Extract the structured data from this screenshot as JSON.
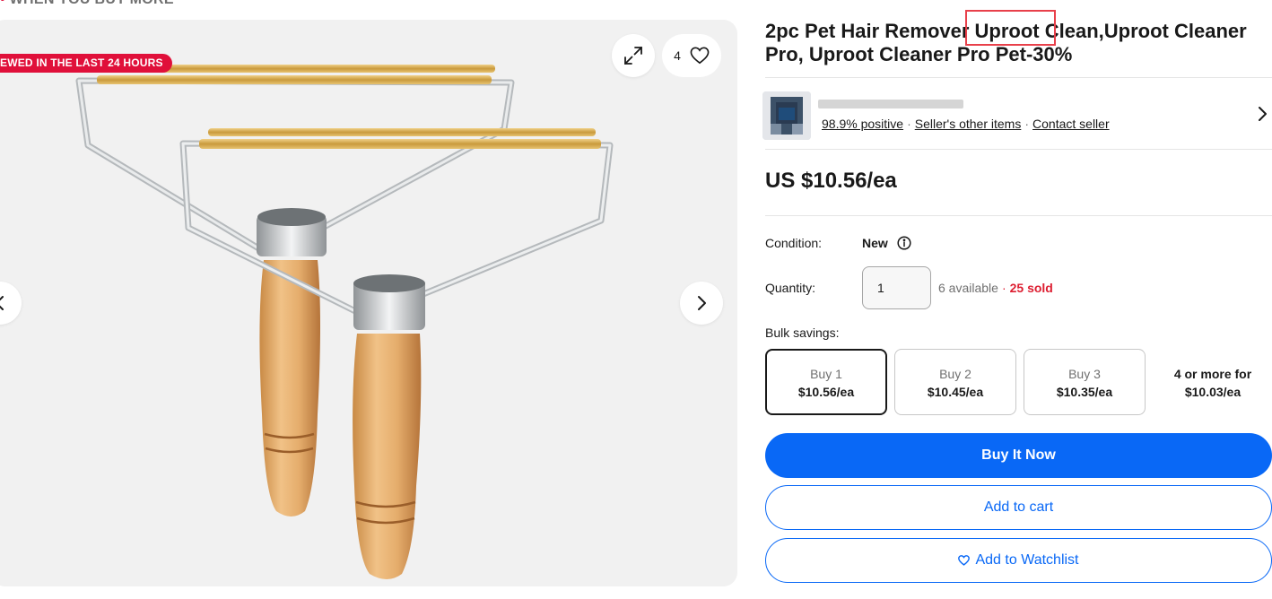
{
  "banner": {
    "text": "WHEN YOU BUY MORE"
  },
  "gallery": {
    "viewed_badge": "EWED IN THE LAST 24 HOURS",
    "watch_count": "4",
    "icons": {
      "expand": "expand-icon",
      "heart": "heart-icon",
      "next": "chevron-right-icon",
      "prev": "chevron-left-icon"
    }
  },
  "product": {
    "title_line1": "2pc Pet Hair Remover Uproot Clean,Uproot Cleaner",
    "title_line2": "Pro, Uproot Cleaner Pro Pet-30%",
    "price": "US $10.56/ea"
  },
  "seller": {
    "feedback": "98.9% positive",
    "other_items": "Seller's other items",
    "contact": "Contact seller"
  },
  "condition": {
    "label": "Condition:",
    "value": "New"
  },
  "quantity": {
    "label": "Quantity:",
    "value": "1",
    "available": "6 available",
    "sold": "25 sold"
  },
  "bulk": {
    "label": "Bulk savings:",
    "options": [
      {
        "qty": "Buy 1",
        "price": "$10.56/ea"
      },
      {
        "qty": "Buy 2",
        "price": "$10.45/ea"
      },
      {
        "qty": "Buy 3",
        "price": "$10.35/ea"
      }
    ],
    "more_line1": "4 or more for",
    "more_line2": "$10.03/ea",
    "selected_index": 0
  },
  "actions": {
    "buy_now": "Buy It Now",
    "add_to_cart": "Add to cart",
    "add_to_watchlist": "Add to Watchlist"
  },
  "colors": {
    "primary_blue": "#0968f6",
    "badge_red": "#e0103a",
    "sold_red": "#dd1e31",
    "highlight_red": "#e8404a"
  }
}
